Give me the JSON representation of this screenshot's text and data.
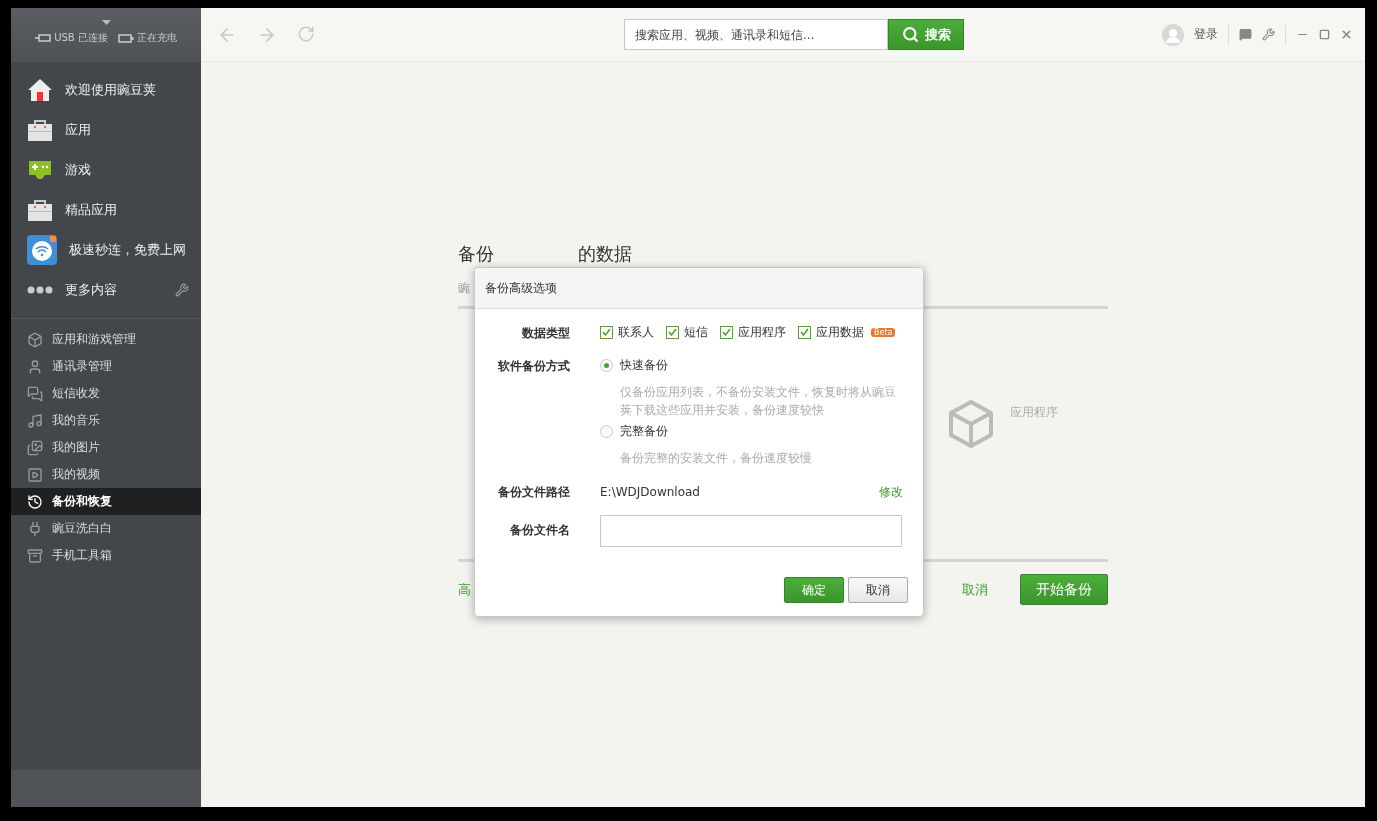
{
  "sidebar": {
    "status": [
      {
        "kind": "usb",
        "label": "USB 已连接"
      },
      {
        "kind": "battery",
        "label": "正在充电"
      }
    ],
    "primary_items": [
      {
        "kind": "home",
        "label": "欢迎使用豌豆荚"
      },
      {
        "kind": "bag",
        "label": "应用"
      },
      {
        "kind": "gamepad",
        "label": "游戏"
      },
      {
        "kind": "bag",
        "label": "精品应用"
      },
      {
        "kind": "wifi",
        "label": "极速秒连，免费上网"
      }
    ],
    "more": {
      "label": "更多内容"
    },
    "items": [
      {
        "kind": "cube",
        "label": "应用和游戏管理",
        "selected": false
      },
      {
        "kind": "person",
        "label": "通讯录管理",
        "selected": false
      },
      {
        "kind": "chat",
        "label": "短信收发",
        "selected": false
      },
      {
        "kind": "music",
        "label": "我的音乐",
        "selected": false
      },
      {
        "kind": "pictures",
        "label": "我的图片",
        "selected": false
      },
      {
        "kind": "video",
        "label": "我的视频",
        "selected": false
      },
      {
        "kind": "history",
        "label": "备份和恢复",
        "selected": true
      },
      {
        "kind": "clean",
        "label": "豌豆洗白白",
        "selected": false
      },
      {
        "kind": "toolbox",
        "label": "手机工具箱",
        "selected": false
      }
    ]
  },
  "toolbar": {
    "search": {
      "placeholder": "搜索应用、视频、通讯录和短信...",
      "button": "搜索"
    },
    "login": "登录"
  },
  "page": {
    "title_start": "备份",
    "title_end": "的数据",
    "subtitle": "豌",
    "app_label": "应用程序",
    "advanced_link": "高",
    "cancel": "取消",
    "start": "开始备份"
  },
  "dialog": {
    "title": "备份高级选项",
    "data_types": {
      "label": "数据类型",
      "items": [
        {
          "label": "联系人",
          "checked": true
        },
        {
          "label": "短信",
          "checked": true
        },
        {
          "label": "应用程序",
          "checked": true
        },
        {
          "label": "应用数据",
          "checked": true,
          "badge": "Beta"
        }
      ]
    },
    "mode": {
      "label": "软件备份方式",
      "options": [
        {
          "label": "快速备份",
          "selected": true,
          "description": "仅备份应用列表，不备份安装文件，恢复时将从豌豆荚下载这些应用并安装，备份速度较快"
        },
        {
          "label": "完整备份",
          "selected": false,
          "description": "备份完整的安装文件，备份速度较慢"
        }
      ]
    },
    "path": {
      "label": "备份文件路径",
      "value": "E:\\WDJDownload",
      "action": "修改"
    },
    "filename": {
      "label": "备份文件名"
    },
    "buttons": {
      "ok": "确定",
      "cancel": "取消"
    }
  }
}
